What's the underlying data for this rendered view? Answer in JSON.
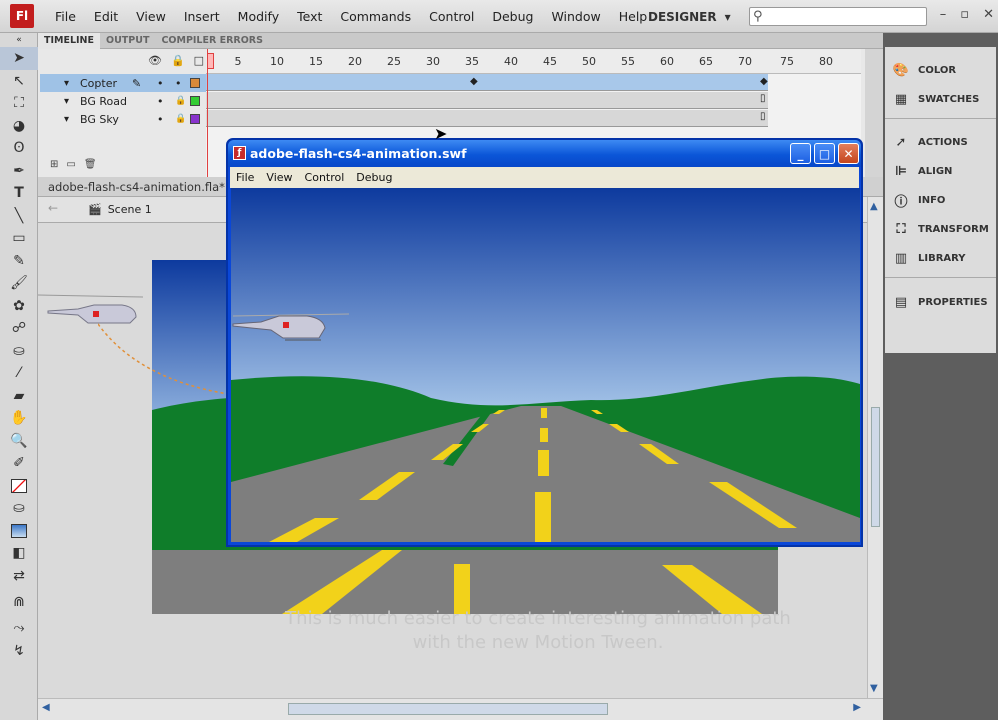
{
  "app": {
    "logo_text": "Fl",
    "workspace": "DESIGNER",
    "search_placeholder": ""
  },
  "menu": [
    "File",
    "Edit",
    "View",
    "Insert",
    "Modify",
    "Text",
    "Commands",
    "Control",
    "Debug",
    "Window",
    "Help"
  ],
  "timeline": {
    "tabs": [
      "TIMELINE",
      "OUTPUT",
      "COMPILER ERRORS"
    ],
    "ruler": [
      "5",
      "10",
      "15",
      "20",
      "25",
      "30",
      "35",
      "40",
      "45",
      "50",
      "55",
      "60",
      "65",
      "70",
      "75",
      "80"
    ],
    "layers": [
      {
        "name": "Copter",
        "color": "#d98a3a",
        "selected": true
      },
      {
        "name": "BG Road",
        "color": "#33cc33",
        "selected": false
      },
      {
        "name": "BG Sky",
        "color": "#8833cc",
        "selected": false
      }
    ]
  },
  "document": {
    "tab": "adobe-flash-cs4-animation.fla*",
    "scene": "Scene 1"
  },
  "caption": "This is much easier to create interesting animation path with the new Motion Tween.",
  "swf_window": {
    "title": "adobe-flash-cs4-animation.swf",
    "menu": [
      "File",
      "View",
      "Control",
      "Debug"
    ]
  },
  "right_panel": {
    "group1": [
      {
        "label": "COLOR",
        "icon": "color-icon"
      },
      {
        "label": "SWATCHES",
        "icon": "swatches-icon"
      }
    ],
    "group2": [
      {
        "label": "ACTIONS",
        "icon": "actions-icon"
      },
      {
        "label": "ALIGN",
        "icon": "align-icon"
      },
      {
        "label": "INFO",
        "icon": "info-icon"
      },
      {
        "label": "TRANSFORM",
        "icon": "transform-icon"
      },
      {
        "label": "LIBRARY",
        "icon": "library-icon"
      }
    ],
    "group3": [
      {
        "label": "PROPERTIES",
        "icon": "properties-icon"
      }
    ]
  },
  "colors": {
    "sky_top": "#0d3a9e",
    "sky_bottom": "#9fc0e6",
    "hill": "#0f7d2a",
    "road": "#7e7e7e",
    "stripe": "#f2d21a",
    "title_bar": "#0b56d8"
  }
}
